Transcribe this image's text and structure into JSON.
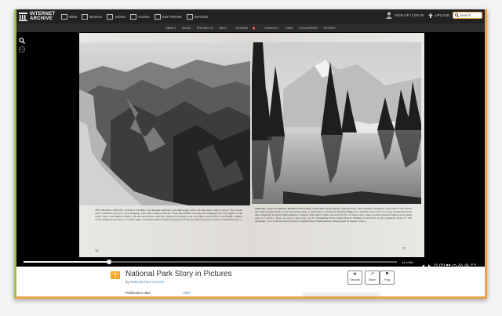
{
  "header": {
    "logo_text": "INTERNET ARCHIVE",
    "media_items": [
      {
        "label": "WEB",
        "icon": "web-icon"
      },
      {
        "label": "BOOKS",
        "icon": "books-icon"
      },
      {
        "label": "VIDEO",
        "icon": "video-icon"
      },
      {
        "label": "AUDIO",
        "icon": "audio-icon"
      },
      {
        "label": "SOFTWARE",
        "icon": "software-icon"
      },
      {
        "label": "IMAGES",
        "icon": "images-icon"
      }
    ],
    "auth_label": "SIGN UP | LOG IN",
    "upload_label": "UPLOAD",
    "search_placeholder": "Search"
  },
  "subnav": {
    "items": [
      "ABOUT",
      "BLOG",
      "PROJECTS",
      "HELP",
      "DONATE",
      "CONTACT",
      "JOBS",
      "VOLUNTEER",
      "PEOPLE"
    ]
  },
  "book": {
    "left_caption": "THE GRAND CANYON, AFTER A STORM. The Autumn naturalist John Burroughs called the mile-deep Grand Canyon \"the world's most wonderful spectacle, ever-changing, alive with a million moods.\" Both the brilliant coloring and seemingly the very shapes of the walls, capes, and temples change with sun and shadow, with the coming of morning, noon, and night. And if there is moonlight, outlines of the temples above show, as a silver light, a thousand spectral forms projected from the inscrutable gloom. (Courtesy Fred Harvey, Inc.)",
    "right_caption": "MIRROR LAKE IN INDIAN HENRY'S HUNTING GROUND, Mount Rainier National Park. This beautiful wilderness, like much of the land in the scenic national parks, is all the heavier park. A road leads to it from the Westfork Highways, 45 miles away; and it is on the Wonderland Trail that completely encircles Mount Rainier. Campers with shelter cabins, spaced from 8 to 12 miles apart, make possible extended hiking and packing trips of a week or more, as well as short ones, on the Wonderland Trail. Indian Henry's Hunting Ground lies on the southwest slope of \"The Mountain,\" as it is affectionately known to neighboring Washingtonians. (Photograph by Asahel Curtis.)",
    "left_page_number": "14",
    "right_page_number": "15"
  },
  "controls": {
    "progress": 0.23,
    "page_count_text": "14 of 88"
  },
  "details": {
    "title": "National Park Story in Pictures",
    "by_label": "by",
    "author": "National Park Service",
    "actions": [
      {
        "label": "Favorite",
        "icon": "favorite-icon",
        "glyph": "★"
      },
      {
        "label": "Share",
        "icon": "share-icon",
        "glyph": "↗"
      },
      {
        "label": "Flag",
        "icon": "flag-icon",
        "glyph": "⚑"
      }
    ],
    "publication_label": "Publication date",
    "publication_value": "1957"
  }
}
